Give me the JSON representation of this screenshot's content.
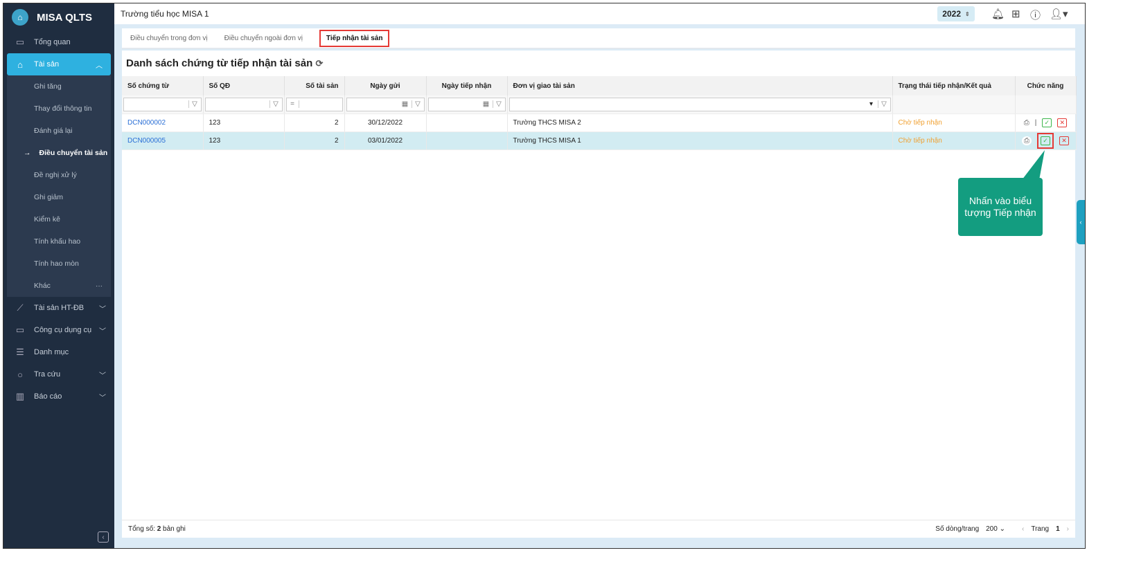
{
  "app": {
    "name": "MISA QLTS",
    "org": "Trường tiểu học MISA 1",
    "year": "2022"
  },
  "sidebar": {
    "items": [
      {
        "label": "Tổng quan",
        "icon": "monitor-icon"
      },
      {
        "label": "Tài sản",
        "icon": "house-car-icon"
      },
      {
        "label": "Tài sản HT-ĐB",
        "icon": "road-icon"
      },
      {
        "label": "Công cụ dụng cụ",
        "icon": "paint-roller-icon"
      },
      {
        "label": "Danh mục",
        "icon": "list-icon"
      },
      {
        "label": "Tra cứu",
        "icon": "search-icon"
      },
      {
        "label": "Báo cáo",
        "icon": "report-icon"
      }
    ],
    "sub": [
      "Ghi tăng",
      "Thay đổi thông tin",
      "Đánh giá lại",
      "Điều chuyển tài sản",
      "Đề nghị xử lý",
      "Ghi giảm",
      "Kiểm kê",
      "Tính khấu hao",
      "Tính hao mòn",
      "Khác"
    ]
  },
  "tabs": [
    "Điều chuyển trong đơn vị",
    "Điều chuyển ngoài đơn vị",
    "Tiếp nhận tài sản"
  ],
  "title": "Danh sách chứng từ tiếp nhận tài sản",
  "columns": [
    "Số chứng từ",
    "Số QĐ",
    "Số tài sản",
    "Ngày gửi",
    "Ngày tiếp nhận",
    "Đơn vị giao tài sản",
    "Trạng thái tiếp nhận/Kết quả",
    "Chức năng"
  ],
  "filter_eq": "=",
  "rows": [
    {
      "code": "DCN000002",
      "qd": "123",
      "count": "2",
      "sent": "30/12/2022",
      "received": "",
      "unit": "Trường THCS MISA 2",
      "status": "Chờ tiếp nhận"
    },
    {
      "code": "DCN000005",
      "qd": "123",
      "count": "2",
      "sent": "03/01/2022",
      "received": "",
      "unit": "Trường THCS MISA 1",
      "status": "Chờ tiếp nhận"
    }
  ],
  "footer": {
    "total_label": "Tổng số:",
    "total": "2",
    "total_suffix": "bản ghi",
    "page_size_label": "Số dòng/trang",
    "page_size": "200",
    "page_label": "Trang",
    "page": "1"
  },
  "callout": "Nhấn vào biểu tượng Tiếp nhận"
}
